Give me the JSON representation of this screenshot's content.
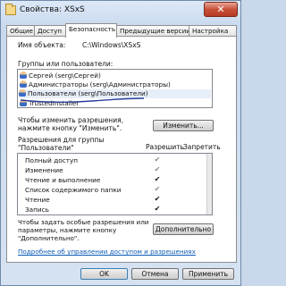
{
  "window": {
    "title": "Свойства: XSxS",
    "close_label": "✕"
  },
  "tabs": [
    "Общие",
    "Доступ",
    "Безопасность",
    "Предыдущие версии",
    "Настройка"
  ],
  "object_label": "Имя объекта:",
  "object_value": "C:\\Windows\\XSxS",
  "groups_label": "Группы или пользователи:",
  "groups": [
    "Сергей (serg\\Сергей)",
    "Администраторы (serg\\Администраторы)",
    "Пользователи (serg\\Пользователи)",
    "TrustedInstaller"
  ],
  "change_hint": "Чтобы изменить разрешения,\nнажмите кнопку \"Изменить\".",
  "change_button": "Изменить...",
  "permissions_label": "Разрешения для группы\n\"Пользователи\"",
  "col_allow": "Разрешить",
  "col_deny": "Запретить",
  "permissions": [
    {
      "name": "Полный доступ",
      "allow": "✔",
      "deny": ""
    },
    {
      "name": "Изменение",
      "allow": "✔",
      "deny": ""
    },
    {
      "name": "Чтение и выполнение",
      "allow": "✔",
      "deny": ""
    },
    {
      "name": "Список содержимого папки",
      "allow": "✔",
      "deny": ""
    },
    {
      "name": "Чтение",
      "allow": "✔",
      "deny": ""
    },
    {
      "name": "Запись",
      "allow": "✔",
      "deny": ""
    }
  ],
  "special_hint": "Чтобы задать особые разрешения или\nпараметры, нажмите кнопку\n\"Дополнительно\".",
  "advanced_button": "Дополнительно",
  "link_text": "Подробнее об управлении доступом и разрешениях",
  "buttons": {
    "ok": "OK",
    "cancel": "Отмена",
    "apply": "Применить"
  }
}
